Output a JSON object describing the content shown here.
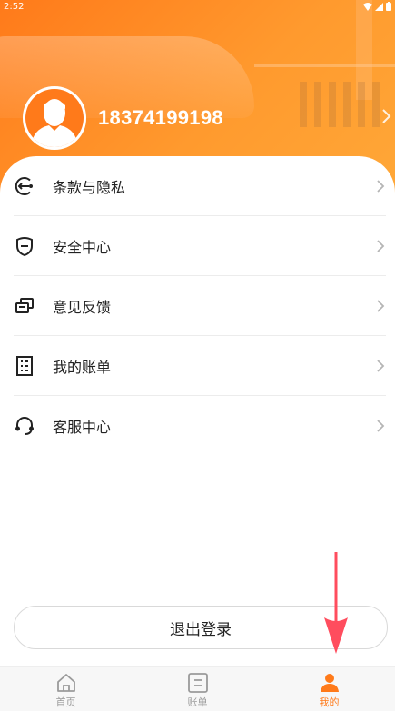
{
  "status_bar": {
    "time": "2:52"
  },
  "profile": {
    "phone": "18374199198"
  },
  "menu": {
    "items": [
      {
        "label": "条款与隐私",
        "icon": "policy-arrow-icon"
      },
      {
        "label": "安全中心",
        "icon": "shield-icon"
      },
      {
        "label": "意见反馈",
        "icon": "feedback-icon"
      },
      {
        "label": "我的账单",
        "icon": "bill-icon"
      },
      {
        "label": "客服中心",
        "icon": "headset-icon"
      }
    ]
  },
  "logout": {
    "label": "退出登录"
  },
  "tabbar": {
    "tabs": [
      {
        "label": "首页",
        "icon": "home-icon",
        "active": false
      },
      {
        "label": "账单",
        "icon": "bill-tab-icon",
        "active": false
      },
      {
        "label": "我的",
        "icon": "person-icon",
        "active": true
      }
    ]
  },
  "colors": {
    "accent": "#ff7a1a",
    "annotation": "#ff4d5e"
  }
}
